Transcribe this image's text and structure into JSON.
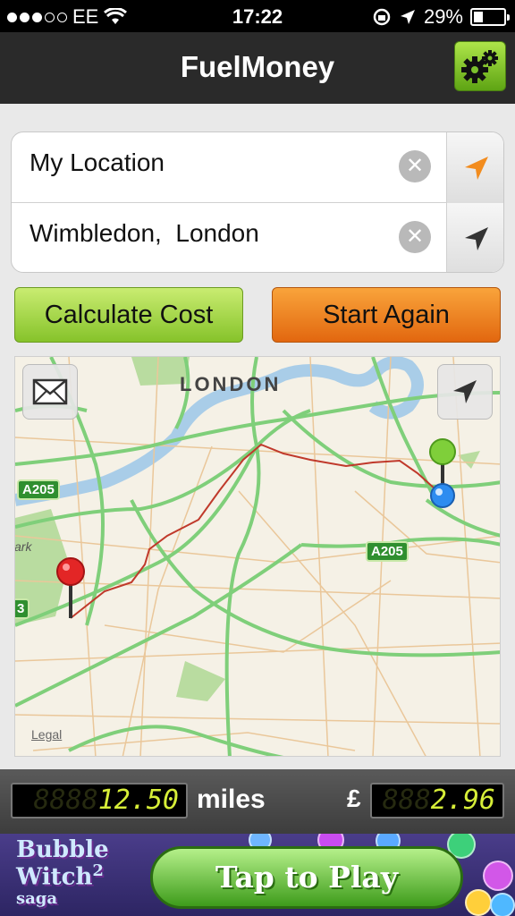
{
  "status_bar": {
    "carrier": "EE",
    "time": "17:22",
    "battery": "29%",
    "signal_bars_filled": 3,
    "signal_bars_total": 5,
    "battery_level": 0.29
  },
  "nav": {
    "title": "FuelMoney",
    "settings_icon": "gear-icon",
    "accent": "#7cc22c"
  },
  "route": {
    "from": {
      "value": "My Location",
      "clear_icon": "close-icon",
      "locate_icon": "location-arrow-icon",
      "locate_color": "#f28c1e"
    },
    "to": {
      "value": "Wimbledon,  London",
      "clear_icon": "close-icon",
      "locate_icon": "location-arrow-icon",
      "locate_color": "#333333"
    }
  },
  "actions": {
    "calculate_label": "Calculate Cost",
    "start_again_label": "Start Again"
  },
  "map": {
    "city_label": "LONDON",
    "road_labels": [
      "A205",
      "A205"
    ],
    "edge_label_park": "ark",
    "edge_label_road": "3",
    "legal_label": "Legal",
    "email_icon": "envelope-icon",
    "locate_icon": "location-arrow-icon"
  },
  "readout": {
    "distance_value": "12.50",
    "distance_ghost": "8888",
    "distance_units": "miles",
    "currency_symbol": "£",
    "cost_value": "2.96",
    "cost_ghost": "888"
  },
  "ad": {
    "brand_line1": "Bubble",
    "brand_line2": "Witch",
    "brand_sup": "2",
    "brand_line3": "saga",
    "cta_label": "Tap to Play"
  }
}
